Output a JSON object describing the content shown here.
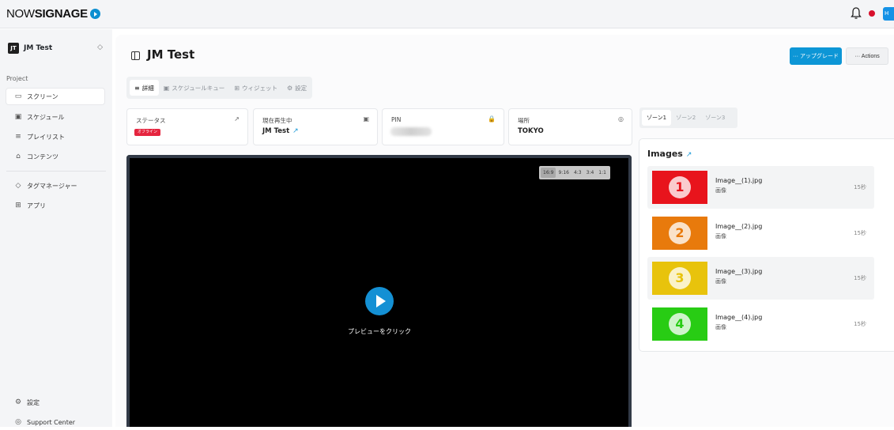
{
  "header": {
    "logo_light": "NOW",
    "logo_bold": "SIGNAGE",
    "user_initials": "H"
  },
  "sidebar": {
    "workspace": {
      "badge": "JT",
      "name": "JM Test",
      "caret": "◇"
    },
    "project_label": "Project",
    "items": [
      {
        "label": "スクリーン",
        "icon": "monitor-icon",
        "glyph": "▭",
        "active": true
      },
      {
        "label": "スケジュール",
        "icon": "calendar-icon",
        "glyph": "▣",
        "active": false
      },
      {
        "label": "プレイリスト",
        "icon": "playlist-icon",
        "glyph": "≡",
        "active": false
      },
      {
        "label": "コンテンツ",
        "icon": "folder-icon",
        "glyph": "⌂",
        "active": false
      },
      {
        "label": "タグマネージャー",
        "icon": "tag-icon",
        "glyph": "◇",
        "active": false
      },
      {
        "label": "アプリ",
        "icon": "apps-icon",
        "glyph": "⊞",
        "active": false
      }
    ],
    "bottom": [
      {
        "label": "設定",
        "icon": "gear-icon",
        "glyph": "⚙"
      },
      {
        "label": "Support Center",
        "icon": "support-icon",
        "glyph": "◎"
      }
    ]
  },
  "main": {
    "title": "JM Test",
    "upgrade_label": "··· アップグレード",
    "actions_label": "··· Actions",
    "tabs": [
      {
        "label": "詳細",
        "glyph": "≡",
        "active": true
      },
      {
        "label": "スケジュールキュー",
        "glyph": "▣",
        "active": false
      },
      {
        "label": "ウィジェット",
        "glyph": "⊞",
        "active": false
      },
      {
        "label": "設定",
        "glyph": "⚙",
        "active": false
      }
    ],
    "cards": {
      "status": {
        "label": "ステータス",
        "badge": "オフライン",
        "icon": "↗"
      },
      "now_playing": {
        "label": "現在再生中",
        "value": "JM Test",
        "icon": "▣",
        "link": "↗"
      },
      "pin": {
        "label": "PIN",
        "icon": "🔒"
      },
      "location": {
        "label": "場所",
        "value": "TOKYO",
        "icon": "◎"
      }
    },
    "zones": [
      {
        "label": "ゾーン1",
        "active": true
      },
      {
        "label": "ゾーン2",
        "active": false
      },
      {
        "label": "ゾーン3",
        "active": false
      }
    ],
    "preview": {
      "ratios": [
        {
          "label": "16:9",
          "active": true
        },
        {
          "label": "9:16",
          "active": false
        },
        {
          "label": "4:3",
          "active": false
        },
        {
          "label": "3:4",
          "active": false
        },
        {
          "label": "1:1",
          "active": false
        }
      ],
      "click_label": "プレビューをクリック"
    },
    "images": {
      "title": "Images",
      "link": "↗",
      "items": [
        {
          "name": "Image__(1).jpg",
          "type": "画像",
          "duration": "15秒",
          "num": "1",
          "color": "#e8141c",
          "num_color": "#e8141c"
        },
        {
          "name": "Image__(2).jpg",
          "type": "画像",
          "duration": "15秒",
          "num": "2",
          "color": "#e87a0c",
          "num_color": "#e87a0c"
        },
        {
          "name": "Image__(3).jpg",
          "type": "画像",
          "duration": "15秒",
          "num": "3",
          "color": "#e8c30c",
          "num_color": "#e8c30c"
        },
        {
          "name": "Image__(4).jpg",
          "type": "画像",
          "duration": "15秒",
          "num": "4",
          "color": "#28cc14",
          "num_color": "#28cc14"
        }
      ]
    }
  }
}
